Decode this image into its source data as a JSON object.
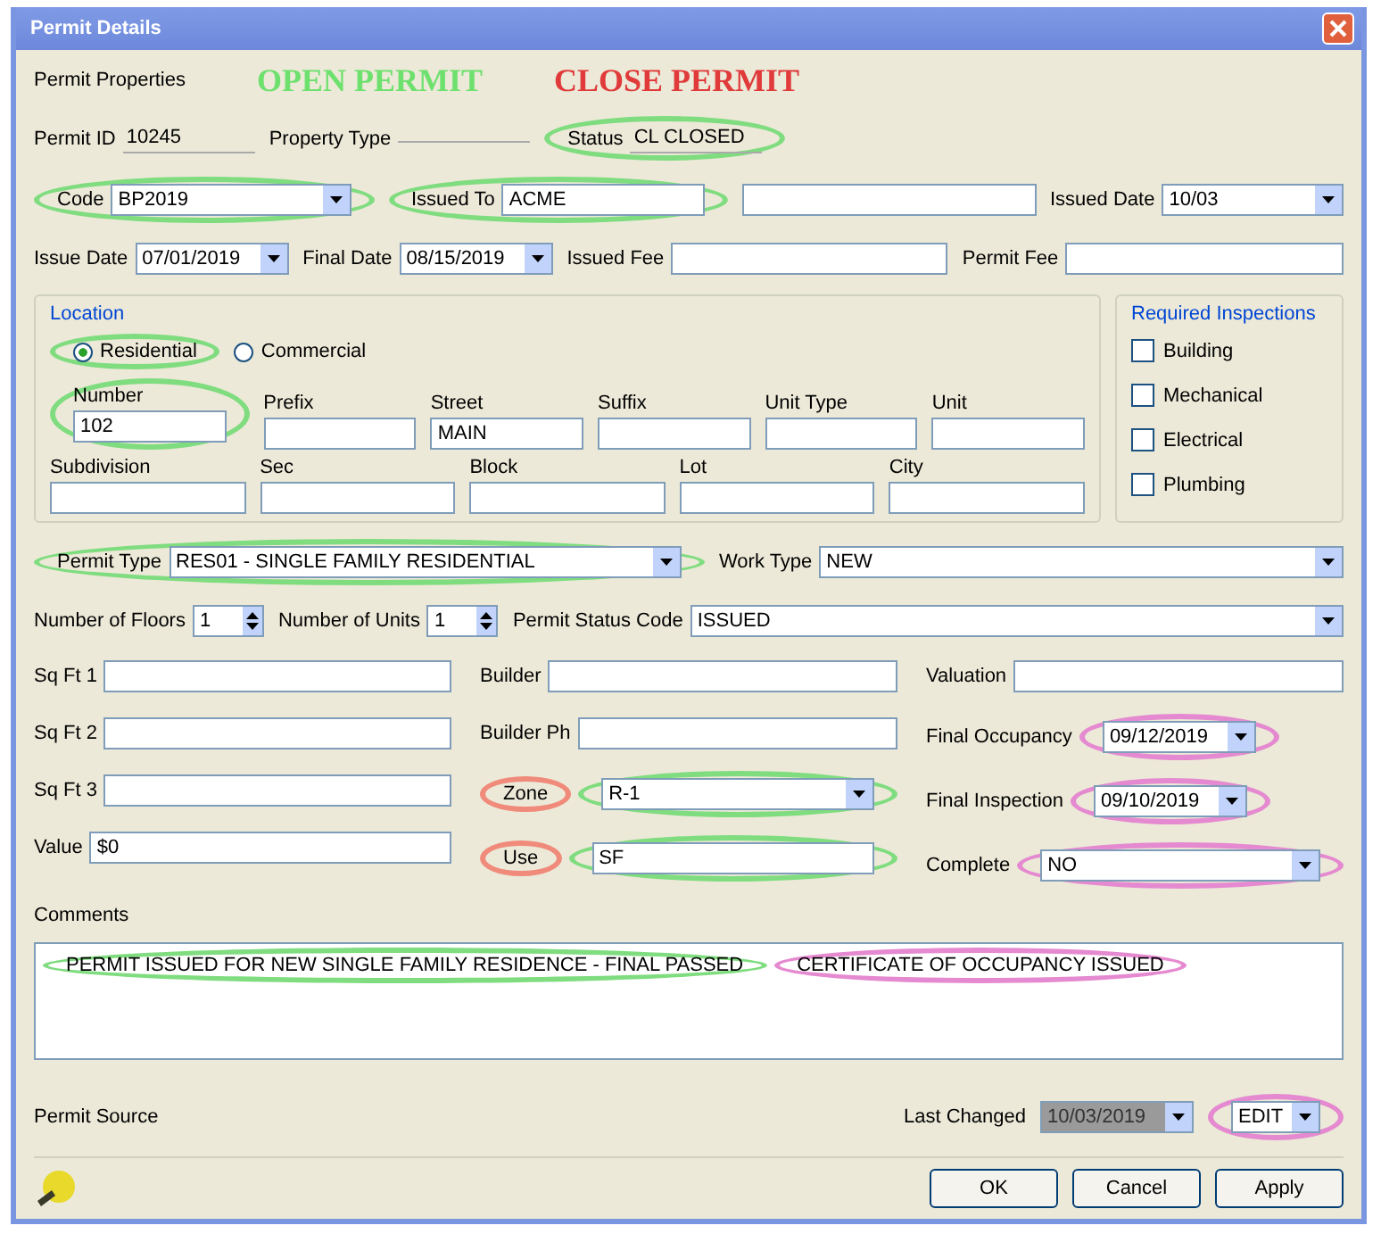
{
  "window": {
    "title": "Permit Details"
  },
  "header": {
    "label": "Permit Properties",
    "open_banner": "OPEN PERMIT",
    "close_banner": "CLOSE PERMIT"
  },
  "top_rows": [
    [
      {
        "kind": "static",
        "label": "Permit ID",
        "value": "10245"
      },
      {
        "kind": "static",
        "label": "Property Type"
      },
      {
        "kind": "static",
        "label": "Status",
        "value": "CL CLOSED",
        "ring": {
          "color": "#7fdc7f"
        }
      }
    ],
    [
      {
        "kind": "combo",
        "label": "Code",
        "value": "BP2019",
        "ring": {
          "color": "#7fdc7f"
        }
      },
      {
        "kind": "field",
        "label": "Issued To",
        "value": "ACME",
        "ring": {
          "color": "#7fdc7f"
        }
      },
      {
        "kind": "field"
      },
      {
        "kind": "combo",
        "label": "Issued Date",
        "value": "10/03"
      }
    ],
    [
      {
        "kind": "date",
        "label": "Issue Date",
        "value": "07/01/2019"
      },
      {
        "kind": "date",
        "label": "Final Date",
        "value": "08/15/2019"
      },
      {
        "kind": "field",
        "label": "Issued Fee"
      },
      {
        "kind": "field",
        "label": "Permit Fee"
      }
    ]
  ],
  "location": {
    "title": "Location",
    "radios": [
      {
        "label": "Residential",
        "selected": true,
        "ring": {
          "color": "#7fdc7f"
        }
      },
      {
        "label": "Commercial",
        "selected": false
      }
    ],
    "rows": [
      [
        {
          "kind": "field",
          "label": "Number",
          "value": "102",
          "ring": {
            "color": "#7fdc7f"
          }
        },
        {
          "kind": "field",
          "label": "Prefix"
        },
        {
          "kind": "field",
          "label": "Street",
          "value": "MAIN"
        },
        {
          "kind": "field",
          "label": "Suffix"
        },
        {
          "kind": "field",
          "label": "Unit Type"
        },
        {
          "kind": "field",
          "label": "Unit"
        }
      ],
      [
        {
          "kind": "field",
          "label": "Subdivision"
        },
        {
          "kind": "field",
          "label": "Sec"
        },
        {
          "kind": "field",
          "label": "Block"
        },
        {
          "kind": "field",
          "label": "Lot"
        },
        {
          "kind": "field",
          "label": "City"
        }
      ]
    ]
  },
  "inspections": {
    "title": "Required Inspections",
    "items": [
      {
        "label": "Building",
        "checked": false
      },
      {
        "label": "Mechanical",
        "checked": false
      },
      {
        "label": "Electrical",
        "checked": false
      },
      {
        "label": "Plumbing",
        "checked": false
      }
    ]
  },
  "mid_rows": [
    [
      {
        "kind": "combo",
        "label": "Permit Type",
        "value": "RES01 - SINGLE FAMILY RESIDENTIAL",
        "ring": {
          "color": "#7fdc7f"
        }
      },
      {
        "kind": "combo",
        "label": "Work Type",
        "value": "NEW"
      }
    ],
    [
      {
        "kind": "spin",
        "label": "Number of Floors",
        "value": "1"
      },
      {
        "kind": "spin",
        "label": "Number of Units",
        "value": "1"
      },
      {
        "kind": "combo",
        "label": "Permit Status Code",
        "value": "ISSUED"
      }
    ]
  ],
  "columns": [
    [
      {
        "kind": "field",
        "label": "Sq Ft 1"
      },
      {
        "kind": "field",
        "label": "Sq Ft 2"
      },
      {
        "kind": "field",
        "label": "Sq Ft 3"
      },
      {
        "kind": "field",
        "label": "Value",
        "value": "$0"
      }
    ],
    [
      {
        "kind": "field",
        "label": "Builder"
      },
      {
        "kind": "field",
        "label": "Builder Ph"
      },
      {
        "kind": "combo",
        "label": "Zone",
        "value": "R-1",
        "label_ring": {
          "color": "#f08a7a"
        },
        "value_ring": {
          "color": "#7fdc7f"
        }
      },
      {
        "kind": "field",
        "label": "Use",
        "value": "SF",
        "label_ring": {
          "color": "#f08a7a"
        },
        "value_ring": {
          "color": "#7fdc7f"
        }
      }
    ],
    [
      {
        "kind": "field",
        "label": "Valuation"
      },
      {
        "kind": "date",
        "label": "Final Occupancy",
        "value": "09/12/2019",
        "value_ring": {
          "color": "#e58ad0"
        }
      },
      {
        "kind": "date",
        "label": "Final Inspection",
        "value": "09/10/2019",
        "value_ring": {
          "color": "#e58ad0"
        }
      },
      {
        "kind": "combo",
        "label": "Complete",
        "value": "NO",
        "value_ring": {
          "color": "#e58ad0"
        }
      }
    ]
  ],
  "comments": {
    "label": "Comments",
    "segments": [
      {
        "text": "PERMIT ISSUED FOR NEW SINGLE FAMILY RESIDENCE - FINAL PASSED",
        "ring": {
          "color": "#7fdc7f"
        }
      },
      {
        "text": "CERTIFICATE OF OCCUPANCY ISSUED",
        "ring": {
          "color": "#e58ad0"
        }
      }
    ]
  },
  "bottom": {
    "source_label": "Permit Source",
    "changed_label": "Last Changed",
    "changed_value": "10/03/2019",
    "edit_value": "EDIT",
    "edit_ring": {
      "color": "#e58ad0"
    }
  },
  "buttons": [
    "OK",
    "Cancel",
    "Apply"
  ]
}
